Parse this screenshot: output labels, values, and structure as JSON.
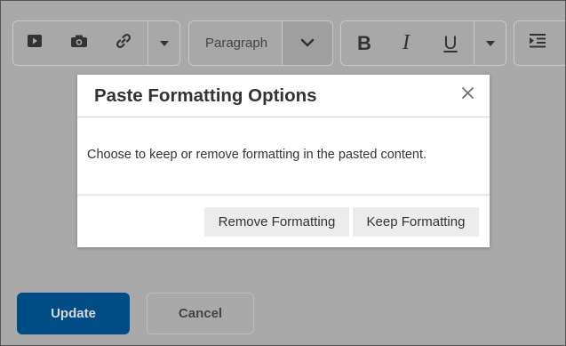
{
  "toolbar": {
    "insert_group": {
      "icons": [
        "video-icon",
        "camera-icon",
        "link-icon",
        "more-caret-icon"
      ]
    },
    "block_format": {
      "selected": "Paragraph",
      "icon": "chevron-down-icon"
    },
    "text_format": {
      "bold": "B",
      "italic": "I",
      "underline": "U",
      "more_icon": "more-caret-icon"
    },
    "indent_icon": "indent-icon"
  },
  "dialog": {
    "title": "Paste Formatting Options",
    "close_icon": "close-icon",
    "message": "Choose to keep or remove formatting in the pasted content.",
    "remove_label": "Remove Formatting",
    "keep_label": "Keep Formatting"
  },
  "footer": {
    "update_label": "Update",
    "cancel_label": "Cancel"
  },
  "colors": {
    "overlay": "#a9a9a9",
    "primary_button": "#004c86",
    "dialog_background": "#ffffff",
    "secondary_button": "#ececec"
  }
}
